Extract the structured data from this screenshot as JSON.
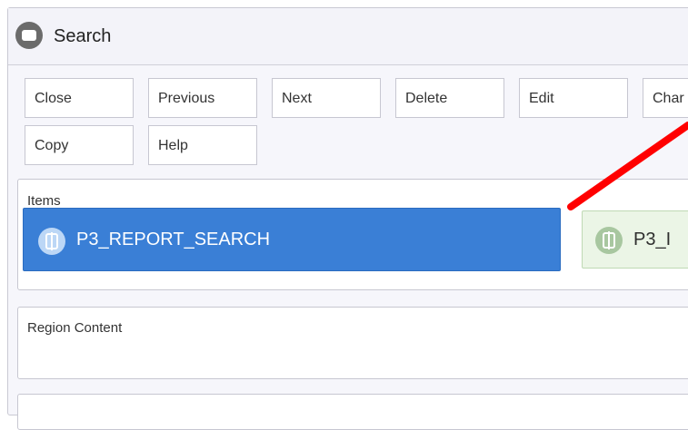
{
  "header": {
    "title": "Search",
    "icon": "region-icon"
  },
  "toolbar": {
    "buttons": [
      {
        "label": "Close"
      },
      {
        "label": "Previous"
      },
      {
        "label": "Next"
      },
      {
        "label": "Delete"
      },
      {
        "label": "Edit"
      },
      {
        "label": "Char"
      },
      {
        "label": "Copy"
      },
      {
        "label": "Help"
      }
    ]
  },
  "items_section": {
    "label": "Items",
    "items": [
      {
        "label": "P3_REPORT_SEARCH",
        "selected": true
      },
      {
        "label": "P3_I",
        "selected": false
      }
    ]
  },
  "region_content": {
    "label": "Region Content"
  },
  "colors": {
    "selected": "#3a7fd6",
    "green_item": "#ebf5e6",
    "annotation_arrow": "#ff0000"
  }
}
